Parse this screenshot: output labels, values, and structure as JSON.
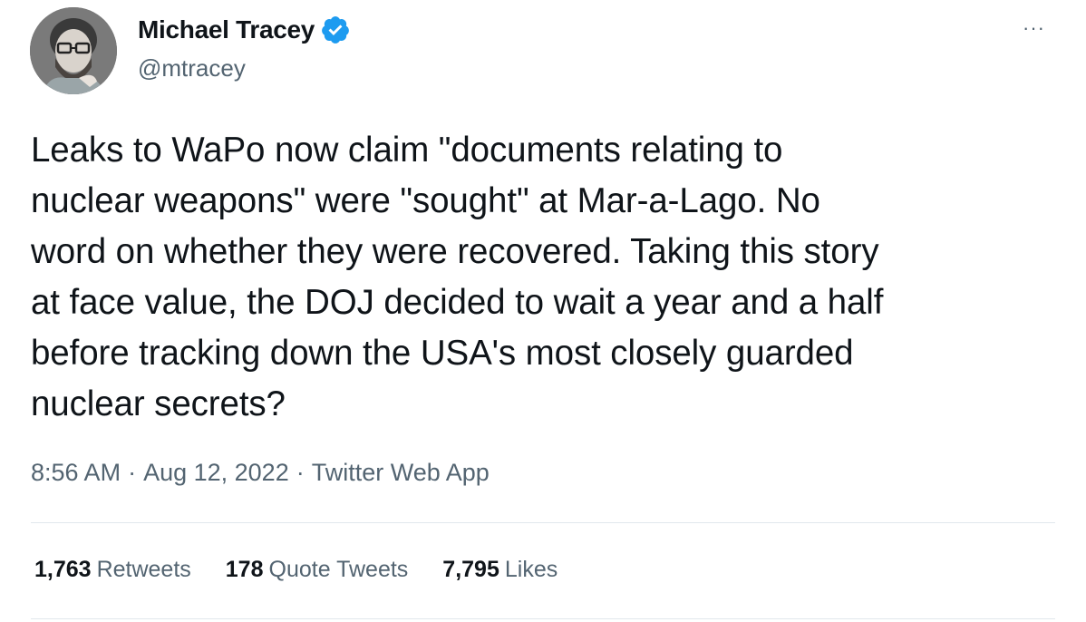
{
  "author": {
    "display_name": "Michael Tracey",
    "handle": "@mtracey",
    "verified_icon": "verified-badge-icon",
    "verified_color": "#1d9bf0"
  },
  "more_menu": "···",
  "tweet": {
    "text": "Leaks to WaPo now claim \"documents relating to\nnuclear weapons\" were \"sought\" at Mar-a-Lago. No\nword on whether they were recovered. Taking this story\nat face value, the DOJ decided to wait a year and a half\nbefore tracking down the USA's most closely guarded\nnuclear secrets?"
  },
  "meta": {
    "time": "8:56 AM",
    "date": "Aug 12, 2022",
    "source": "Twitter Web App",
    "separator": "·"
  },
  "stats": {
    "retweets": {
      "count": "1,763",
      "label": "Retweets"
    },
    "quotes": {
      "count": "178",
      "label": "Quote Tweets"
    },
    "likes": {
      "count": "7,795",
      "label": "Likes"
    }
  }
}
